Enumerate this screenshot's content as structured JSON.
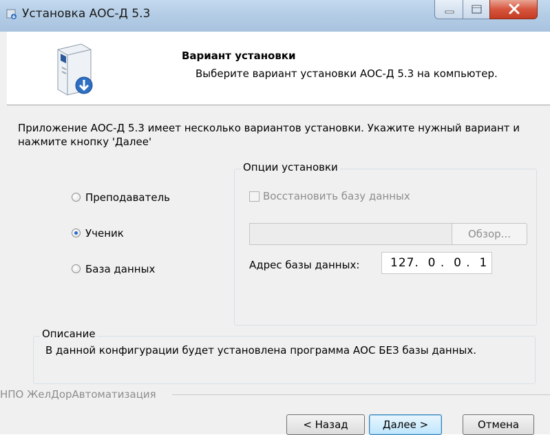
{
  "window": {
    "title": "Установка АОС-Д 5.3",
    "controls": {
      "minimize": "minimize",
      "maximize": "maximize",
      "close": "close"
    }
  },
  "header": {
    "title": "Вариант установки",
    "subtitle": "Выберите вариант установки АОС-Д 5.3 на компьютер."
  },
  "intro": "Приложение АОС-Д 5.3 имеет несколько вариантов установки. Укажите нужный вариант и нажмите кнопку 'Далее'",
  "install_options": {
    "selected": "Ученик",
    "items": [
      {
        "label": "Преподаватель",
        "checked": false
      },
      {
        "label": "Ученик",
        "checked": true
      },
      {
        "label": "База данных",
        "checked": false
      }
    ]
  },
  "options_group": {
    "legend": "Опции установки",
    "restore_db_label": "Восстановить базу данных",
    "restore_db_checked": false,
    "path_value": "",
    "browse_label": "Обзор...",
    "address_label": "Адрес базы данных:",
    "address_value": "127.  0 .  0 .  1"
  },
  "description": {
    "legend": "Описание",
    "text": "В данной конфигурации будет установлена программа АОС БЕЗ базы данных."
  },
  "footer": {
    "company": "НПО ЖелДорАвтоматизация",
    "back_label": "< Назад",
    "next_label": "Далее >",
    "cancel_label": "Отмена"
  },
  "colors": {
    "title_bar": "#b4cde6",
    "close_button": "#d7553e",
    "default_button_border": "#3c7fb1",
    "disabled_text": "#8d8d8d",
    "radio_dot": "#2a6acb"
  },
  "icons": {
    "title": "installer-icon",
    "header": "setup-box-icon"
  }
}
